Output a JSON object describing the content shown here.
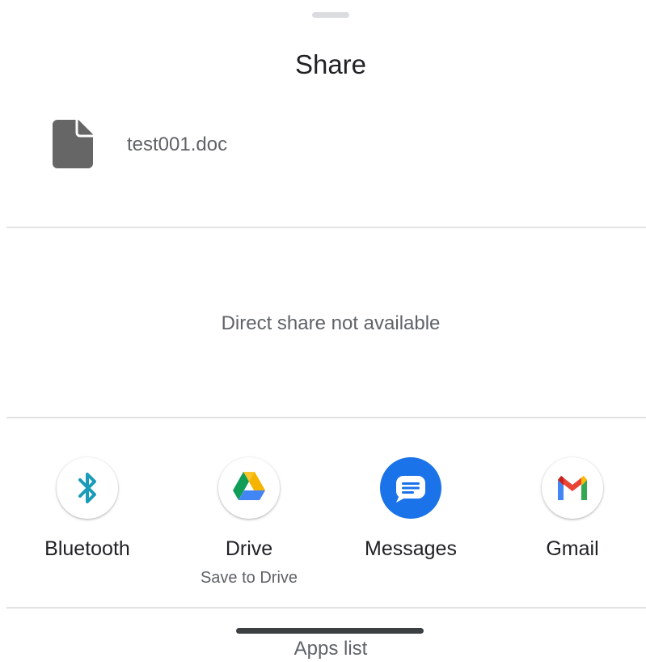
{
  "sheet": {
    "title": "Share",
    "file": {
      "name": "test001.doc",
      "icon": "document-icon"
    },
    "direct_share_message": "Direct share not available",
    "targets": [
      {
        "label": "Bluetooth",
        "sublabel": "",
        "icon": "bluetooth-icon"
      },
      {
        "label": "Drive",
        "sublabel": "Save to Drive",
        "icon": "google-drive-icon"
      },
      {
        "label": "Messages",
        "sublabel": "",
        "icon": "messages-icon"
      },
      {
        "label": "Gmail",
        "sublabel": "",
        "icon": "gmail-icon"
      }
    ],
    "apps_list_label": "Apps list"
  },
  "colors": {
    "bluetooth": "#1a9bb8",
    "drive_green": "#0f9d58",
    "drive_yellow": "#f4b400",
    "drive_blue": "#4285f4",
    "messages_blue": "#1a73e8",
    "gmail_red": "#ea4335",
    "gmail_blue": "#4285f4",
    "gmail_green": "#34a853",
    "gmail_yellow": "#fbbc04",
    "file_icon": "#666666"
  }
}
